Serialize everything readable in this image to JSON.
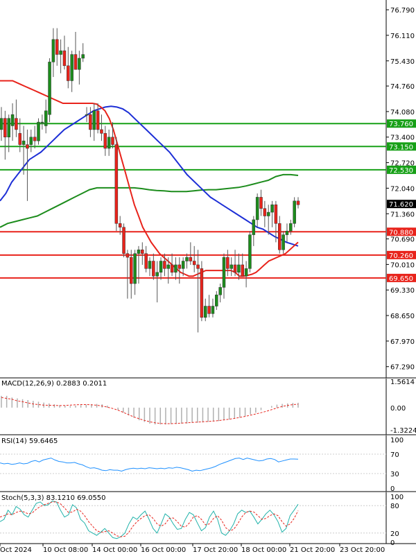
{
  "chart_data": {
    "type": "candlestick",
    "main": {
      "y_ticks": [
        "76.790",
        "76.110",
        "75.430",
        "74.760",
        "74.080",
        "73.400",
        "72.720",
        "72.040",
        "71.360",
        "70.690",
        "70.010",
        "69.330",
        "68.650",
        "67.970",
        "67.290"
      ],
      "ylim": [
        66.99,
        77.05
      ],
      "current_price": "71.620",
      "levels": [
        {
          "label": "73.760",
          "value": 73.76,
          "color": "#17a017"
        },
        {
          "label": "73.150",
          "value": 73.15,
          "color": "#17a017"
        },
        {
          "label": "72.530",
          "value": 72.53,
          "color": "#17a017"
        },
        {
          "label": "70.880",
          "value": 70.88,
          "color": "#e8231b"
        },
        {
          "label": "70.260",
          "value": 70.26,
          "color": "#e8231b"
        },
        {
          "label": "69.650",
          "value": 69.65,
          "color": "#e8231b"
        }
      ],
      "candles": [
        {
          "o": 73.6,
          "h": 74.2,
          "l": 73.3,
          "c": 73.9
        },
        {
          "o": 73.9,
          "h": 74.1,
          "l": 72.8,
          "c": 73.4
        },
        {
          "o": 73.4,
          "h": 74.0,
          "l": 73.0,
          "c": 73.9
        },
        {
          "o": 73.7,
          "h": 74.3,
          "l": 73.3,
          "c": 74.0
        },
        {
          "o": 73.9,
          "h": 74.4,
          "l": 73.4,
          "c": 73.6
        },
        {
          "o": 73.5,
          "h": 73.9,
          "l": 73.0,
          "c": 73.2
        },
        {
          "o": 73.2,
          "h": 73.7,
          "l": 72.4,
          "c": 73.3
        },
        {
          "o": 73.2,
          "h": 73.6,
          "l": 71.7,
          "c": 73.1
        },
        {
          "o": 73.2,
          "h": 73.6,
          "l": 73.0,
          "c": 73.4
        },
        {
          "o": 73.4,
          "h": 73.7,
          "l": 73.1,
          "c": 73.3
        },
        {
          "o": 73.3,
          "h": 73.9,
          "l": 73.2,
          "c": 73.8
        },
        {
          "o": 73.8,
          "h": 74.0,
          "l": 73.6,
          "c": 73.8
        },
        {
          "o": 73.7,
          "h": 74.4,
          "l": 73.5,
          "c": 74.1
        },
        {
          "o": 74.0,
          "h": 75.5,
          "l": 73.8,
          "c": 75.4
        },
        {
          "o": 75.4,
          "h": 76.3,
          "l": 75.0,
          "c": 76.0
        },
        {
          "o": 76.0,
          "h": 76.3,
          "l": 75.3,
          "c": 75.6
        },
        {
          "o": 75.6,
          "h": 76.0,
          "l": 75.1,
          "c": 75.7
        },
        {
          "o": 75.7,
          "h": 76.1,
          "l": 75.2,
          "c": 75.3
        },
        {
          "o": 75.3,
          "h": 75.8,
          "l": 74.7,
          "c": 74.9
        },
        {
          "o": 74.9,
          "h": 75.7,
          "l": 74.6,
          "c": 75.6
        },
        {
          "o": 75.6,
          "h": 76.2,
          "l": 75.2,
          "c": 75.2
        },
        {
          "o": 75.2,
          "h": 75.7,
          "l": 74.8,
          "c": 75.5
        },
        {
          "o": 75.5,
          "h": 75.9,
          "l": 75.4,
          "c": 75.6
        },
        {
          "o": 74.0,
          "h": 74.2,
          "l": 73.8,
          "c": 74.0
        },
        {
          "o": 74.0,
          "h": 74.2,
          "l": 73.4,
          "c": 73.6
        },
        {
          "o": 73.6,
          "h": 74.3,
          "l": 73.3,
          "c": 74.1
        },
        {
          "o": 74.1,
          "h": 74.3,
          "l": 73.5,
          "c": 73.6
        },
        {
          "o": 73.6,
          "h": 74.0,
          "l": 73.3,
          "c": 73.5
        },
        {
          "o": 73.5,
          "h": 73.7,
          "l": 72.9,
          "c": 73.1
        },
        {
          "o": 73.1,
          "h": 73.6,
          "l": 72.9,
          "c": 73.4
        },
        {
          "o": 73.4,
          "h": 73.8,
          "l": 73.1,
          "c": 73.2
        },
        {
          "o": 73.2,
          "h": 73.4,
          "l": 70.9,
          "c": 71.1
        },
        {
          "o": 71.1,
          "h": 71.3,
          "l": 70.8,
          "c": 71.0
        },
        {
          "o": 71.0,
          "h": 71.1,
          "l": 70.2,
          "c": 70.3
        },
        {
          "o": 70.3,
          "h": 70.4,
          "l": 69.1,
          "c": 70.2
        },
        {
          "o": 70.2,
          "h": 70.4,
          "l": 69.1,
          "c": 69.5
        },
        {
          "o": 69.5,
          "h": 70.4,
          "l": 69.2,
          "c": 70.3
        },
        {
          "o": 70.3,
          "h": 70.5,
          "l": 69.5,
          "c": 70.4
        },
        {
          "o": 70.4,
          "h": 70.6,
          "l": 70.0,
          "c": 70.3
        },
        {
          "o": 70.3,
          "h": 70.5,
          "l": 69.8,
          "c": 69.9
        },
        {
          "o": 69.9,
          "h": 70.2,
          "l": 69.7,
          "c": 70.1
        },
        {
          "o": 70.1,
          "h": 70.3,
          "l": 69.6,
          "c": 69.7
        },
        {
          "o": 69.7,
          "h": 70.1,
          "l": 69.0,
          "c": 69.8
        },
        {
          "o": 69.8,
          "h": 70.2,
          "l": 69.6,
          "c": 70.1
        },
        {
          "o": 70.1,
          "h": 70.3,
          "l": 69.7,
          "c": 69.9
        },
        {
          "o": 69.9,
          "h": 70.2,
          "l": 69.5,
          "c": 70.0
        },
        {
          "o": 70.0,
          "h": 70.3,
          "l": 69.7,
          "c": 69.8
        },
        {
          "o": 69.8,
          "h": 70.2,
          "l": 69.6,
          "c": 70.0
        },
        {
          "o": 70.0,
          "h": 70.2,
          "l": 69.5,
          "c": 69.9
        },
        {
          "o": 69.9,
          "h": 70.2,
          "l": 69.7,
          "c": 70.1
        },
        {
          "o": 70.1,
          "h": 70.3,
          "l": 69.9,
          "c": 70.2
        },
        {
          "o": 70.2,
          "h": 70.6,
          "l": 70.0,
          "c": 70.1
        },
        {
          "o": 70.1,
          "h": 70.5,
          "l": 69.8,
          "c": 70.0
        },
        {
          "o": 70.0,
          "h": 70.4,
          "l": 68.2,
          "c": 69.9
        },
        {
          "o": 69.9,
          "h": 70.1,
          "l": 68.5,
          "c": 68.6
        },
        {
          "o": 68.6,
          "h": 69.1,
          "l": 68.5,
          "c": 68.9
        },
        {
          "o": 68.9,
          "h": 69.2,
          "l": 68.6,
          "c": 68.7
        },
        {
          "o": 68.7,
          "h": 69.1,
          "l": 68.6,
          "c": 68.9
        },
        {
          "o": 68.9,
          "h": 69.3,
          "l": 68.8,
          "c": 69.2
        },
        {
          "o": 69.2,
          "h": 69.5,
          "l": 69.0,
          "c": 69.4
        },
        {
          "o": 69.4,
          "h": 70.3,
          "l": 69.1,
          "c": 70.2
        },
        {
          "o": 70.2,
          "h": 70.4,
          "l": 69.7,
          "c": 69.9
        },
        {
          "o": 69.9,
          "h": 70.2,
          "l": 69.7,
          "c": 70.0
        },
        {
          "o": 70.0,
          "h": 70.4,
          "l": 69.7,
          "c": 69.8
        },
        {
          "o": 69.8,
          "h": 70.3,
          "l": 69.6,
          "c": 70.0
        },
        {
          "o": 70.0,
          "h": 70.3,
          "l": 69.8,
          "c": 69.7
        },
        {
          "o": 69.7,
          "h": 70.1,
          "l": 69.4,
          "c": 69.9
        },
        {
          "o": 69.9,
          "h": 70.9,
          "l": 69.8,
          "c": 70.8
        },
        {
          "o": 70.8,
          "h": 71.3,
          "l": 70.5,
          "c": 71.2
        },
        {
          "o": 71.2,
          "h": 71.9,
          "l": 71.0,
          "c": 71.8
        },
        {
          "o": 71.8,
          "h": 72.0,
          "l": 71.3,
          "c": 71.5
        },
        {
          "o": 71.5,
          "h": 71.7,
          "l": 71.0,
          "c": 71.3
        },
        {
          "o": 71.3,
          "h": 71.6,
          "l": 70.8,
          "c": 71.4
        },
        {
          "o": 71.4,
          "h": 71.7,
          "l": 71.0,
          "c": 71.6
        },
        {
          "o": 71.6,
          "h": 71.7,
          "l": 70.6,
          "c": 71.1
        },
        {
          "o": 71.1,
          "h": 71.3,
          "l": 70.3,
          "c": 70.4
        },
        {
          "o": 70.4,
          "h": 70.9,
          "l": 70.3,
          "c": 70.8
        },
        {
          "o": 70.8,
          "h": 71.1,
          "l": 70.6,
          "c": 70.9
        },
        {
          "o": 70.9,
          "h": 71.2,
          "l": 70.8,
          "c": 71.1
        },
        {
          "o": 71.1,
          "h": 71.8,
          "l": 71.0,
          "c": 71.7
        },
        {
          "o": 71.7,
          "h": 71.8,
          "l": 71.5,
          "c": 71.6
        }
      ],
      "ma_red": [
        74.9,
        74.9,
        74.9,
        74.9,
        74.85,
        74.8,
        74.75,
        74.7,
        74.65,
        74.6,
        74.55,
        74.5,
        74.45,
        74.4,
        74.35,
        74.3,
        74.3,
        74.3,
        74.3,
        74.3,
        74.3,
        74.3,
        74.3,
        74.28,
        74.2,
        74.1,
        73.9,
        73.6,
        73.2,
        72.8,
        72.4,
        72.0,
        71.6,
        71.3,
        71.0,
        70.8,
        70.6,
        70.45,
        70.3,
        70.2,
        70.1,
        70.0,
        69.9,
        69.8,
        69.75,
        69.7,
        69.7,
        69.75,
        69.8,
        69.85,
        69.85,
        69.85,
        69.85,
        69.85,
        69.85,
        69.85,
        69.8,
        69.7,
        69.7,
        69.72,
        69.75,
        69.8,
        69.9,
        70.0,
        70.1,
        70.15,
        70.2,
        70.25,
        70.3,
        70.4,
        70.5,
        70.6
      ],
      "ma_blue": [
        71.7,
        71.9,
        72.2,
        72.4,
        72.6,
        72.8,
        72.9,
        73.0,
        73.15,
        73.3,
        73.45,
        73.6,
        73.7,
        73.8,
        73.9,
        74.0,
        74.1,
        74.15,
        74.2,
        74.22,
        74.2,
        74.15,
        74.05,
        73.9,
        73.75,
        73.6,
        73.45,
        73.3,
        73.15,
        73.0,
        72.8,
        72.6,
        72.4,
        72.25,
        72.1,
        71.95,
        71.8,
        71.7,
        71.6,
        71.5,
        71.4,
        71.3,
        71.2,
        71.1,
        71.0,
        70.95,
        70.85,
        70.75,
        70.68,
        70.6,
        70.55,
        70.5
      ],
      "ma_green": [
        71.0,
        71.1,
        71.15,
        71.2,
        71.25,
        71.3,
        71.4,
        71.5,
        71.6,
        71.7,
        71.8,
        71.9,
        72.0,
        72.05,
        72.05,
        72.05,
        72.05,
        72.05,
        72.05,
        72.03,
        72.0,
        71.98,
        71.97,
        71.95,
        71.95,
        71.95,
        71.97,
        71.99,
        72.0,
        72.0,
        72.02,
        72.04,
        72.06,
        72.1,
        72.15,
        72.2,
        72.25,
        72.35,
        72.4,
        72.4,
        72.38
      ]
    },
    "macd": {
      "label": "MACD(12,26,9) 0.2883 0.2011",
      "y_ticks": [
        "1.5614",
        "0.00",
        "-1.3224"
      ],
      "ylim": [
        -1.3224,
        1.5614
      ],
      "histogram": [
        0.7,
        0.7,
        0.6,
        0.55,
        0.5,
        0.45,
        0.4,
        0.35,
        0.3,
        0.25,
        0.2,
        0.15,
        0.12,
        0.1,
        0.12,
        0.15,
        0.18,
        0.2,
        0.22,
        0.2,
        0.12,
        0.0,
        -0.15,
        -0.3,
        -0.45,
        -0.6,
        -0.75,
        -0.85,
        -0.95,
        -1.0,
        -1.0,
        -1.0,
        -0.98,
        -0.97,
        -0.95,
        -0.95,
        -0.9,
        -0.9,
        -0.88,
        -0.85,
        -0.82,
        -0.8,
        -0.75,
        -0.7,
        -0.65,
        -0.6,
        -0.5,
        -0.4,
        -0.3,
        -0.15,
        0.0,
        0.1,
        0.18,
        0.22,
        0.25,
        0.28,
        0.29
      ],
      "signal": [
        0.6,
        0.55,
        0.5,
        0.4,
        0.35,
        0.28,
        0.22,
        0.18,
        0.15,
        0.14,
        0.13,
        0.12,
        0.13,
        0.15,
        0.17,
        0.18,
        0.18,
        0.17,
        0.14,
        0.1,
        0.03,
        -0.05,
        -0.15,
        -0.28,
        -0.42,
        -0.55,
        -0.66,
        -0.76,
        -0.84,
        -0.9,
        -0.94,
        -0.95,
        -0.95,
        -0.94,
        -0.92,
        -0.9,
        -0.88,
        -0.86,
        -0.84,
        -0.82,
        -0.8,
        -0.77,
        -0.73,
        -0.69,
        -0.64,
        -0.58,
        -0.52,
        -0.45,
        -0.38,
        -0.3,
        -0.22,
        -0.12,
        -0.02,
        0.07,
        0.13,
        0.18,
        0.2
      ]
    },
    "rsi": {
      "label": "RSI(14) 59.6465",
      "y_ticks": [
        "100",
        "70",
        "30",
        "0"
      ],
      "ylim": [
        0,
        100
      ],
      "values": [
        52,
        50,
        51,
        49,
        50,
        52,
        50,
        51,
        55,
        57,
        54,
        58,
        60,
        62,
        58,
        55,
        54,
        52,
        52,
        53,
        50,
        48,
        44,
        41,
        42,
        40,
        37,
        36,
        38,
        37,
        37,
        35,
        38,
        40,
        41,
        40,
        41,
        40,
        42,
        41,
        40,
        41,
        40,
        42,
        41,
        43,
        42,
        40,
        38,
        35,
        37,
        36,
        38,
        40,
        42,
        45,
        49,
        52,
        55,
        58,
        61,
        62,
        59,
        62,
        60,
        58,
        56,
        57,
        60,
        61,
        59,
        54,
        56,
        58,
        60,
        60,
        59.6
      ]
    },
    "stoch": {
      "label": "Stoch(5,3,3) 83.1210 69.0550",
      "y_ticks": [
        "100",
        "80",
        "20",
        "0"
      ],
      "ylim": [
        0,
        100
      ],
      "k": [
        45,
        50,
        70,
        60,
        78,
        72,
        60,
        55,
        70,
        85,
        88,
        80,
        82,
        90,
        88,
        70,
        55,
        60,
        82,
        75,
        50,
        42,
        25,
        20,
        15,
        22,
        30,
        20,
        10,
        8,
        12,
        20,
        40,
        55,
        50,
        60,
        68,
        50,
        30,
        20,
        40,
        62,
        55,
        40,
        28,
        30,
        50,
        65,
        60,
        42,
        25,
        32,
        55,
        68,
        50,
        20,
        15,
        25,
        40,
        62,
        70,
        65,
        68,
        55,
        40,
        50,
        62,
        70,
        60,
        45,
        22,
        30,
        58,
        70,
        83
      ],
      "d": [
        55,
        58,
        62,
        60,
        65,
        68,
        66,
        62,
        64,
        72,
        78,
        82,
        85,
        88,
        88,
        84,
        75,
        65,
        66,
        72,
        68,
        58,
        45,
        35,
        25,
        22,
        23,
        25,
        20,
        14,
        12,
        13,
        22,
        35,
        45,
        52,
        58,
        60,
        52,
        40,
        35,
        40,
        52,
        53,
        45,
        35,
        33,
        42,
        55,
        58,
        50,
        38,
        40,
        52,
        58,
        48,
        32,
        25,
        28,
        40,
        55,
        65,
        68,
        66,
        58,
        50,
        52,
        58,
        62,
        58,
        45,
        35,
        40,
        52,
        69
      ]
    },
    "x_labels": [
      "Oct 2024",
      "10 Oct 08:00",
      "14 Oct 00:00",
      "16 Oct 00:00",
      "17 Oct 20:00",
      "18 Oct 00:00",
      "21 Oct 20:00",
      "23 Oct 20:00"
    ]
  }
}
